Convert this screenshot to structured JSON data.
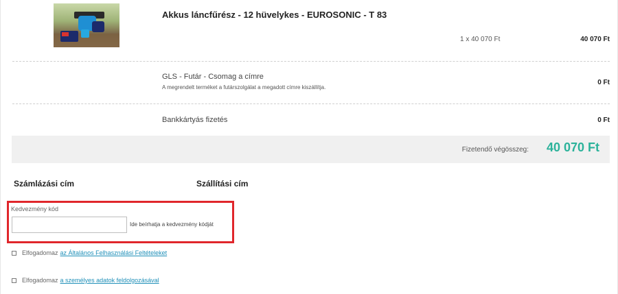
{
  "product": {
    "title": "Akkus láncfűrész - 12 hüvelykes - EUROSONIC - T 83",
    "qty_line": "1 x 40 070 Ft",
    "price": "40 070 Ft",
    "image_icon": "chainsaw-product-image"
  },
  "shipping": {
    "title": "GLS - Futár - Csomag a címre",
    "description": "A megrendelt terméket a futárszolgálat a megadott címre kiszállítja.",
    "price": "0 Ft"
  },
  "payment": {
    "title": "Bankkártyás fizetés",
    "price": "0 Ft"
  },
  "total": {
    "label": "Fizetendő végösszeg:",
    "value": "40 070 Ft"
  },
  "sections": {
    "billing": "Számlázási cím",
    "delivery": "Szállítási cím"
  },
  "coupon": {
    "label": "Kedvezmény kód",
    "value": "",
    "hint": "Ide beírhatja a kedvezmény kódját"
  },
  "consents": [
    {
      "prefix": "Elfogadomaz",
      "link": "az Általános Felhasználási Feltételeket"
    },
    {
      "prefix": "Elfogadomaz",
      "link": "a személyes adatok feldolgozásával"
    }
  ],
  "colors": {
    "accent": "#2bb29a",
    "highlight_border": "#e0262b",
    "link": "#1e8fb8"
  }
}
